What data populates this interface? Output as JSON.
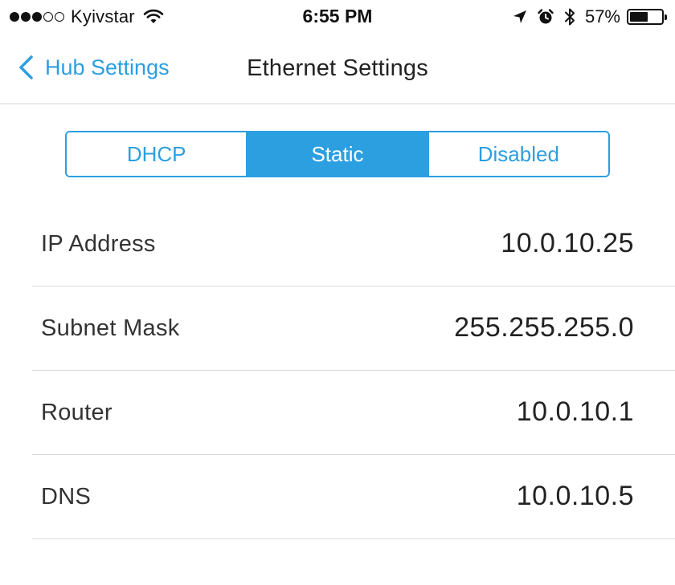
{
  "status_bar": {
    "carrier": "Kyivstar",
    "signal_bars_filled": 3,
    "signal_bars_total": 5,
    "time": "6:55 PM",
    "battery_percent": "57%",
    "battery_level": 0.57,
    "icons": [
      "wifi-icon",
      "location-arrow-icon",
      "alarm-icon",
      "bluetooth-icon",
      "battery-icon"
    ]
  },
  "nav": {
    "back_label": "Hub Settings",
    "title": "Ethernet Settings"
  },
  "segmented": {
    "options": [
      "DHCP",
      "Static",
      "Disabled"
    ],
    "selected": "Static"
  },
  "settings": [
    {
      "label": "IP Address",
      "value": "10.0.10.25"
    },
    {
      "label": "Subnet Mask",
      "value": "255.255.255.0"
    },
    {
      "label": "Router",
      "value": "10.0.10.1"
    },
    {
      "label": "DNS",
      "value": "10.0.10.5"
    }
  ],
  "colors": {
    "accent": "#2b9fe0",
    "divider": "#d9d9d9",
    "text": "#333333"
  }
}
